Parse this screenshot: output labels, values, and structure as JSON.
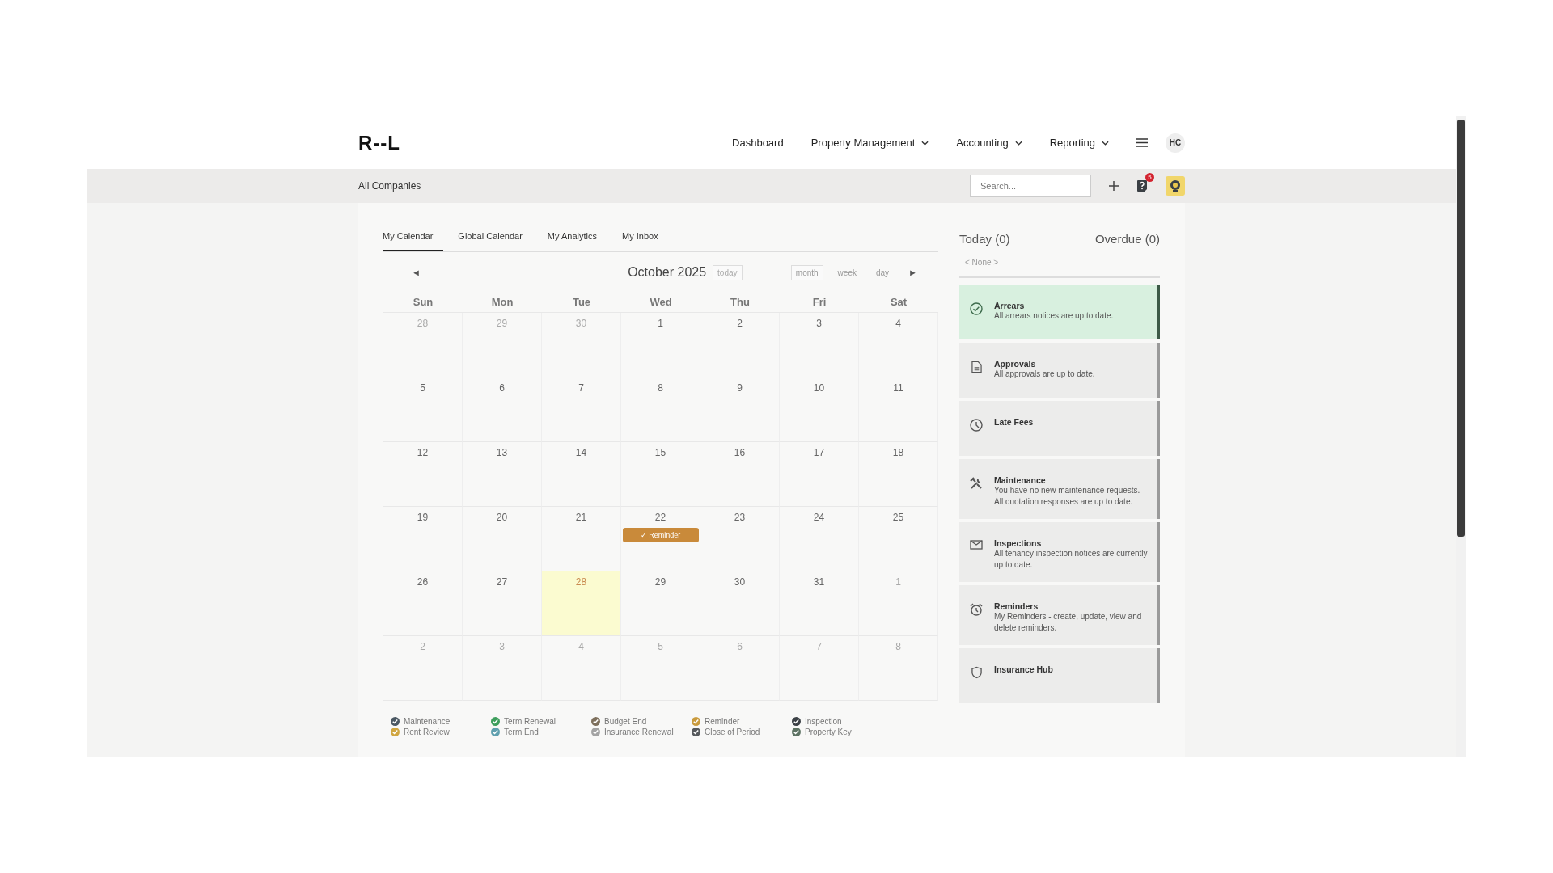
{
  "header": {
    "logo": "R--L",
    "nav": [
      {
        "label": "Dashboard",
        "has_menu": false
      },
      {
        "label": "Property Management",
        "has_menu": true
      },
      {
        "label": "Accounting",
        "has_menu": true
      },
      {
        "label": "Reporting",
        "has_menu": true
      }
    ],
    "user_initials": "HC"
  },
  "subbar": {
    "company": "All Companies",
    "search": {
      "placeholder": "Search..."
    },
    "help_badge": "5"
  },
  "tabs": [
    {
      "label": "My Calendar",
      "selected": true
    },
    {
      "label": "Global Calendar",
      "selected": false
    },
    {
      "label": "My Analytics",
      "selected": false
    },
    {
      "label": "My Inbox",
      "selected": false
    }
  ],
  "calendar": {
    "prev": "◄",
    "next": "►",
    "title": "October 2025",
    "today_button": {
      "label": "today",
      "disabled": true
    },
    "views": [
      {
        "label": "month",
        "selected": true
      },
      {
        "label": "week",
        "selected": false
      },
      {
        "label": "day",
        "selected": false
      }
    ],
    "weekdays": [
      "Sun",
      "Mon",
      "Tue",
      "Wed",
      "Thu",
      "Fri",
      "Sat"
    ],
    "weeks": [
      [
        {
          "label": "28",
          "other_month": true,
          "today": false
        },
        {
          "label": "29",
          "other_month": true,
          "today": false
        },
        {
          "label": "30",
          "other_month": true,
          "today": false
        },
        {
          "label": "1",
          "other_month": false,
          "today": false
        },
        {
          "label": "2",
          "other_month": false,
          "today": false
        },
        {
          "label": "3",
          "other_month": false,
          "today": false
        },
        {
          "label": "4",
          "other_month": false,
          "today": false
        }
      ],
      [
        {
          "label": "5",
          "other_month": false,
          "today": false
        },
        {
          "label": "6",
          "other_month": false,
          "today": false
        },
        {
          "label": "7",
          "other_month": false,
          "today": false
        },
        {
          "label": "8",
          "other_month": false,
          "today": false
        },
        {
          "label": "9",
          "other_month": false,
          "today": false
        },
        {
          "label": "10",
          "other_month": false,
          "today": false
        },
        {
          "label": "11",
          "other_month": false,
          "today": false
        }
      ],
      [
        {
          "label": "12",
          "other_month": false,
          "today": false
        },
        {
          "label": "13",
          "other_month": false,
          "today": false
        },
        {
          "label": "14",
          "other_month": false,
          "today": false
        },
        {
          "label": "15",
          "other_month": false,
          "today": false
        },
        {
          "label": "16",
          "other_month": false,
          "today": false
        },
        {
          "label": "17",
          "other_month": false,
          "today": false
        },
        {
          "label": "18",
          "other_month": false,
          "today": false
        }
      ],
      [
        {
          "label": "19",
          "other_month": false,
          "today": false
        },
        {
          "label": "20",
          "other_month": false,
          "today": false
        },
        {
          "label": "21",
          "other_month": false,
          "today": false
        },
        {
          "label": "22",
          "other_month": false,
          "today": false,
          "events": [
            {
              "label": "✓ Reminder",
              "color": "#c98a3a"
            }
          ]
        },
        {
          "label": "23",
          "other_month": false,
          "today": false
        },
        {
          "label": "24",
          "other_month": false,
          "today": false
        },
        {
          "label": "25",
          "other_month": false,
          "today": false
        }
      ],
      [
        {
          "label": "26",
          "other_month": false,
          "today": false
        },
        {
          "label": "27",
          "other_month": false,
          "today": false
        },
        {
          "label": "28",
          "other_month": false,
          "today": true
        },
        {
          "label": "29",
          "other_month": false,
          "today": false
        },
        {
          "label": "30",
          "other_month": false,
          "today": false
        },
        {
          "label": "31",
          "other_month": false,
          "today": false
        },
        {
          "label": "1",
          "other_month": true,
          "today": false
        }
      ],
      [
        {
          "label": "2",
          "other_month": true,
          "today": false
        },
        {
          "label": "3",
          "other_month": true,
          "today": false
        },
        {
          "label": "4",
          "other_month": true,
          "today": false
        },
        {
          "label": "5",
          "other_month": true,
          "today": false
        },
        {
          "label": "6",
          "other_month": true,
          "today": false
        },
        {
          "label": "7",
          "other_month": true,
          "today": false
        },
        {
          "label": "8",
          "other_month": true,
          "today": false
        }
      ]
    ]
  },
  "legend": [
    {
      "label": "Maintenance",
      "color": "#4b5863"
    },
    {
      "label": "Term Renewal",
      "color": "#3d9e5c"
    },
    {
      "label": "Budget End",
      "color": "#7d6f5c"
    },
    {
      "label": "Reminder",
      "color": "#c99a3c"
    },
    {
      "label": "Inspection",
      "color": "#3b4046"
    },
    {
      "label": "Rent Review",
      "color": "#d0a640"
    },
    {
      "label": "Term End",
      "color": "#5f9fae"
    },
    {
      "label": "Insurance Renewal",
      "color": "#a3a3a3"
    },
    {
      "label": "Close of Period",
      "color": "#56595c"
    },
    {
      "label": "Property Key",
      "color": "#5d7263"
    }
  ],
  "tasks": {
    "today": "Today (0)",
    "overdue": "Overdue (0)",
    "empty": "< None >"
  },
  "cards": [
    {
      "title": "Arrears",
      "lines": [
        "All arrears notices are up to date."
      ],
      "highlighted": true
    },
    {
      "title": "Approvals",
      "lines": [
        "All approvals are up to date."
      ],
      "highlighted": false
    },
    {
      "title": "Late Fees",
      "highlighted": false
    },
    {
      "title": "Maintenance",
      "lines": [
        "You have no new maintenance requests.",
        "All quotation responses are up to date."
      ],
      "highlighted": false
    },
    {
      "title": "Inspections",
      "lines": [
        "All tenancy inspection notices are currently up to date."
      ],
      "highlighted": false
    },
    {
      "title": "Reminders",
      "lines": [
        "My Reminders - create, update, view and delete reminders."
      ],
      "highlighted": false
    },
    {
      "title": "Insurance Hub",
      "highlighted": false
    }
  ]
}
